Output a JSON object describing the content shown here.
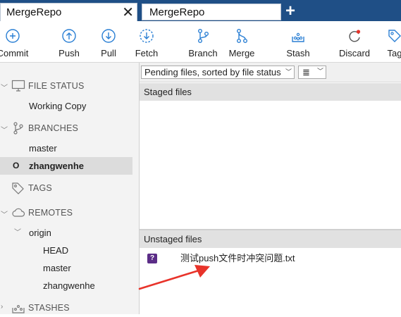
{
  "tabs": [
    {
      "title": "MergeRepo",
      "close": "✕"
    },
    {
      "title": "MergeRepo"
    }
  ],
  "new_tab": "+",
  "toolbar": {
    "commit": "Commit",
    "push": "Push",
    "pull": "Pull",
    "fetch": "Fetch",
    "branch": "Branch",
    "merge": "Merge",
    "stash": "Stash",
    "discard": "Discard",
    "tag": "Tag"
  },
  "sidebar": {
    "file_status": {
      "title": "FILE STATUS",
      "items": [
        "Working Copy"
      ]
    },
    "branches": {
      "title": "BRANCHES",
      "items": [
        "master",
        "zhangwenhe"
      ],
      "current": "zhangwenhe",
      "current_marker": "O"
    },
    "tags": {
      "title": "TAGS"
    },
    "remotes": {
      "title": "REMOTES",
      "origin": "origin",
      "origin_items": [
        "HEAD",
        "master",
        "zhangwenhe"
      ]
    },
    "stashes": {
      "title": "STASHES"
    }
  },
  "filter": {
    "sort_label": "Pending files, sorted by file status",
    "view_icon": "≣"
  },
  "staged": {
    "header": "Staged files",
    "files": []
  },
  "unstaged": {
    "header": "Unstaged files",
    "files": [
      {
        "status": "?",
        "name": "测试push文件时冲突问题.txt"
      }
    ]
  },
  "colors": {
    "tab_bar": "#1f4f86",
    "accent": "#2a7fd4",
    "untracked": "#5b2d87",
    "arrow": "#e8332a"
  },
  "icons": [
    "commit-icon",
    "push-icon",
    "pull-icon",
    "fetch-icon",
    "branch-icon",
    "merge-icon",
    "stash-icon",
    "discard-icon",
    "tag-icon",
    "monitor-icon",
    "branch-icon",
    "tag-icon",
    "cloud-icon",
    "stash-icon"
  ]
}
